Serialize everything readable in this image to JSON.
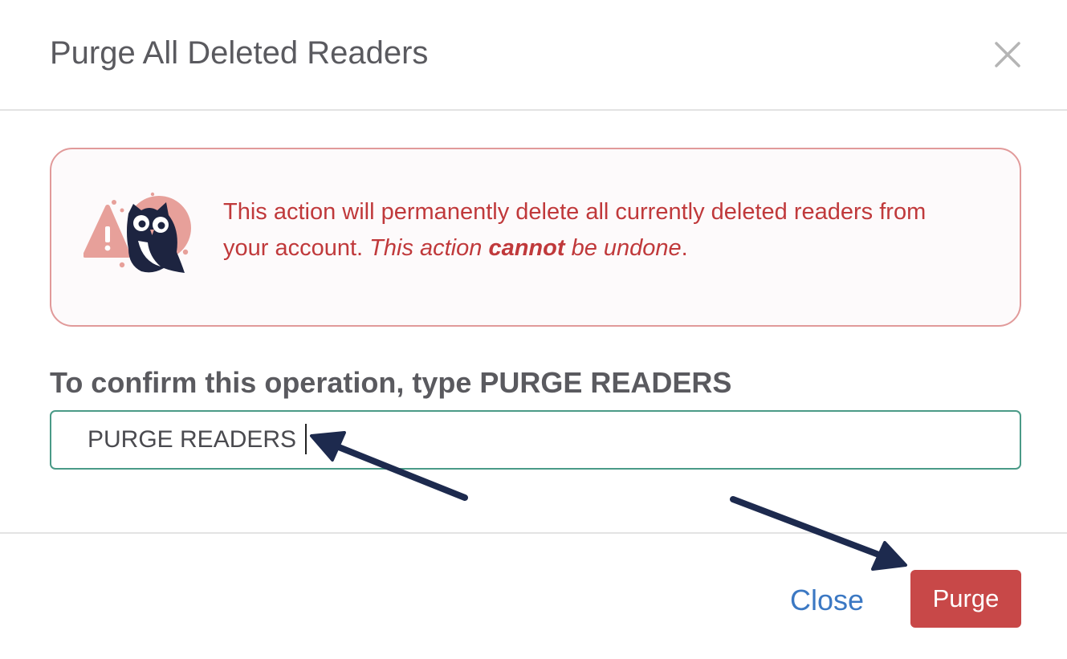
{
  "modal": {
    "title": "Purge All Deleted Readers",
    "close_icon": "close-x-icon"
  },
  "alert": {
    "illustration_icon": "owl-warning-icon",
    "text_part1": "This action will permanently delete all currently deleted readers from your account. ",
    "text_italic1": "This action ",
    "text_bold": "cannot",
    "text_italic2": " be undone",
    "text_end": ".",
    "color": "#c0393b"
  },
  "confirm": {
    "label": "To confirm this operation, type PURGE READERS",
    "input_value": "PURGE READERS"
  },
  "footer": {
    "close_label": "Close",
    "purge_label": "Purge",
    "purge_color": "#c84848"
  },
  "annotations": {
    "arrow_color": "#1d2a4e",
    "arrow_icon": "annotation-arrow-icon"
  }
}
